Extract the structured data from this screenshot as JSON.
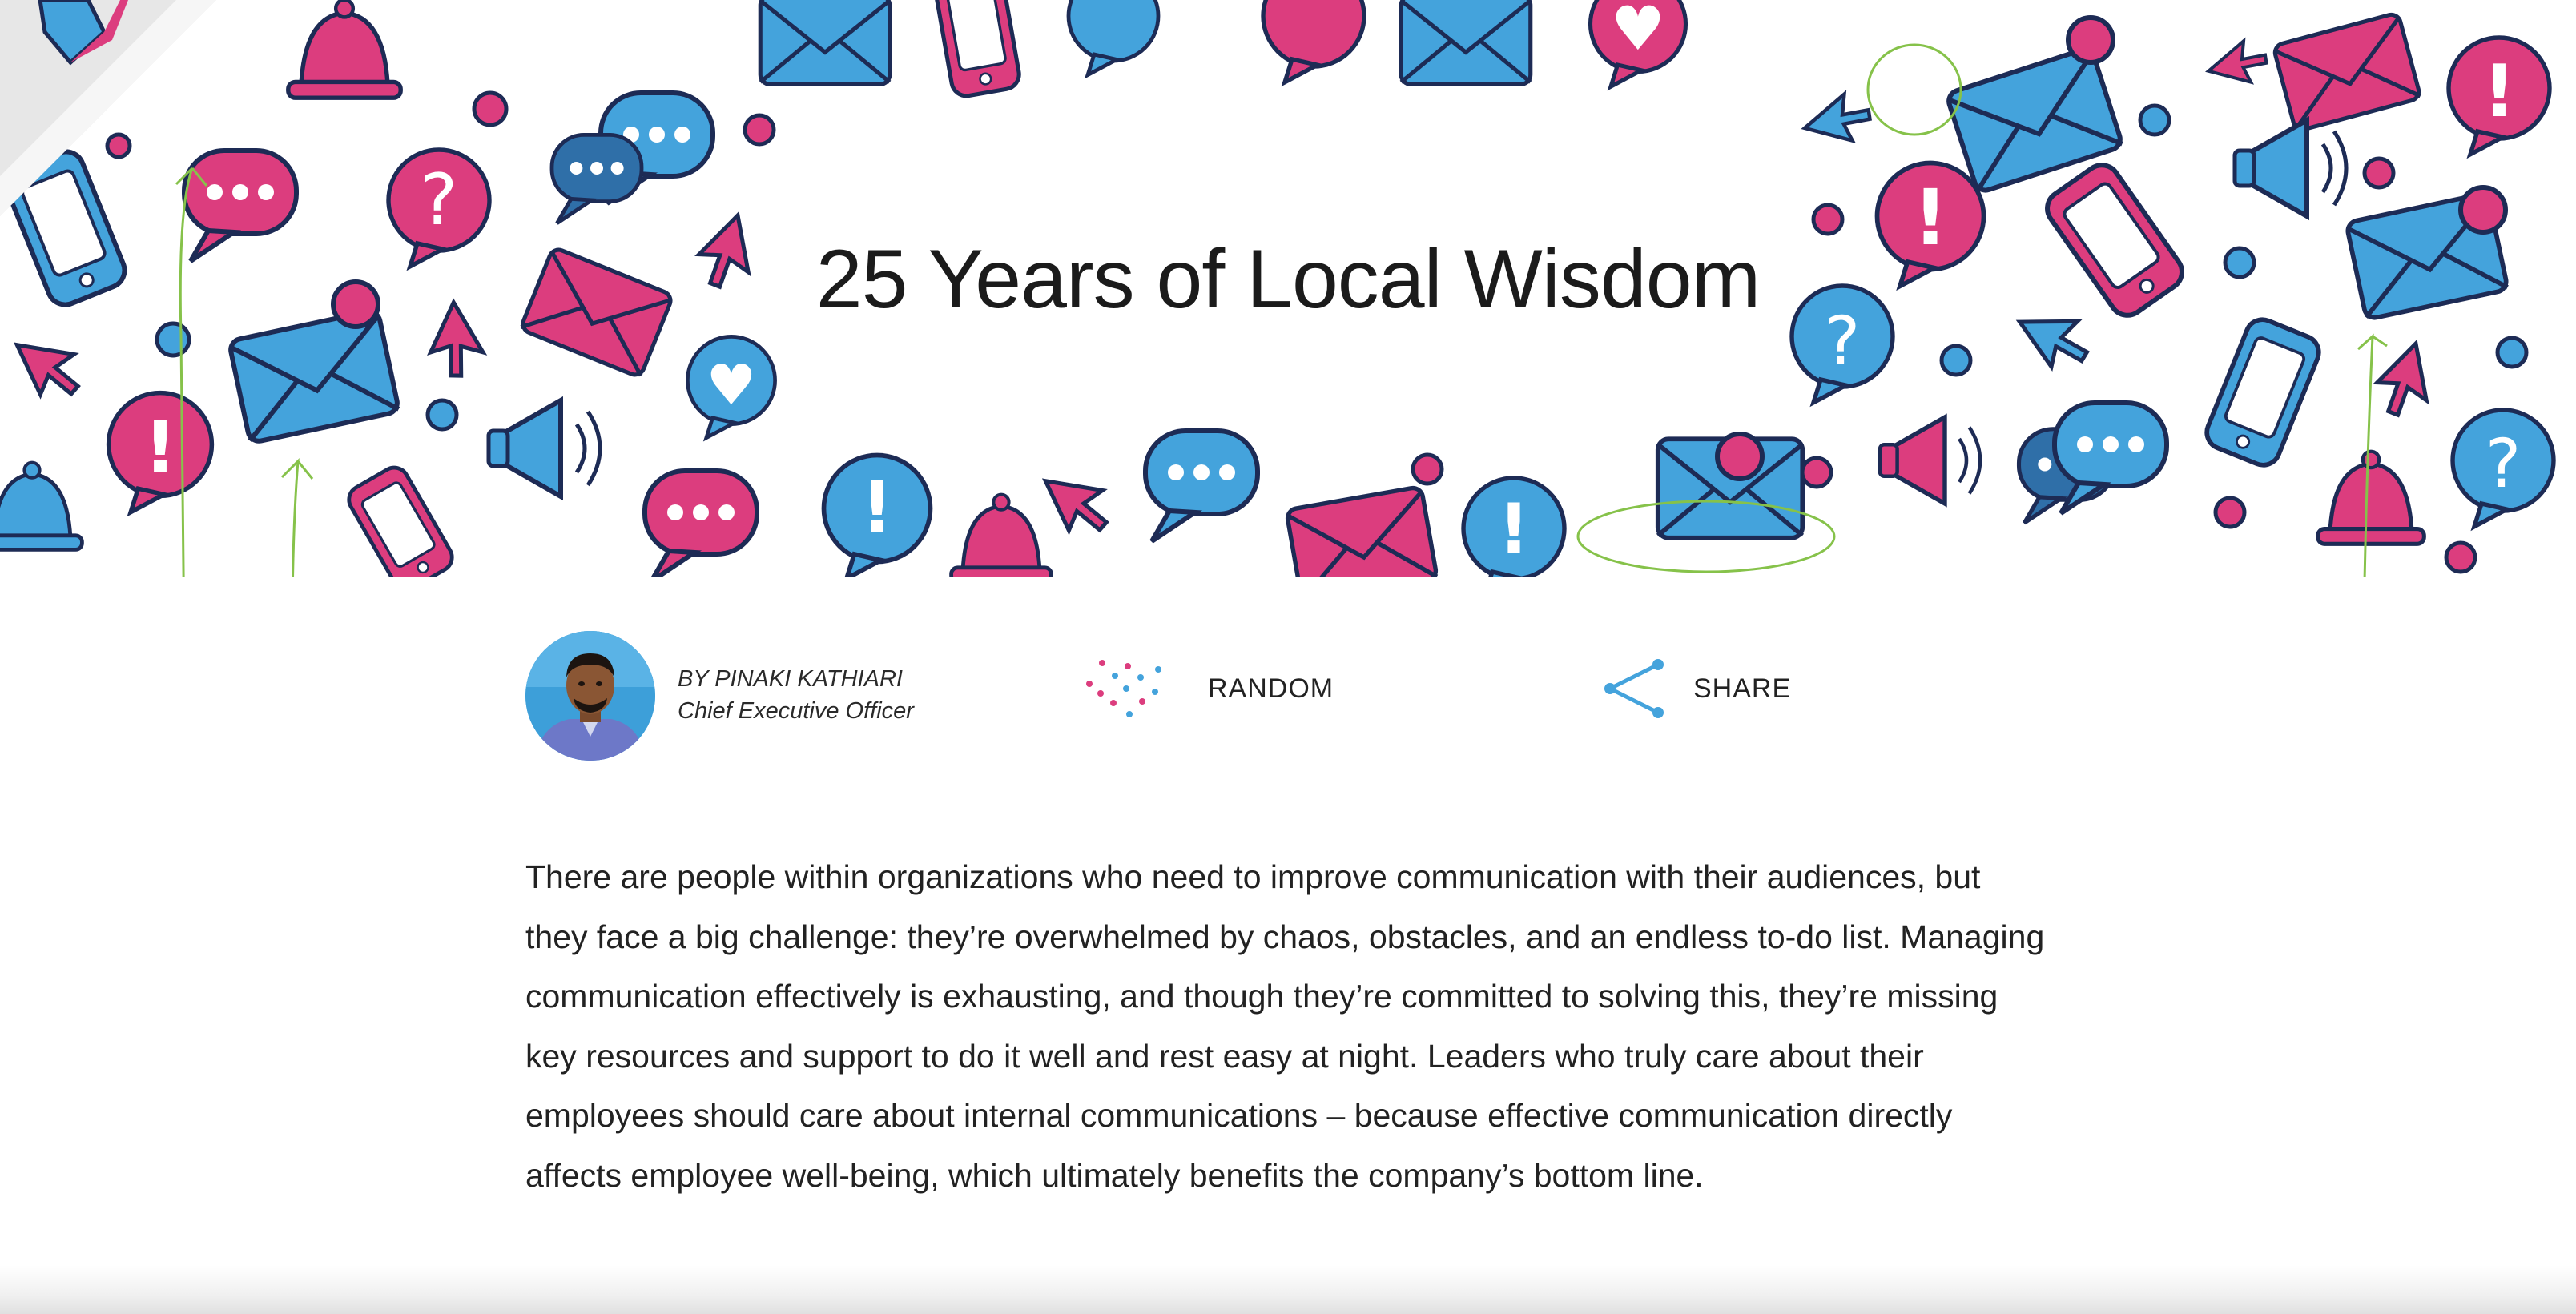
{
  "hero": {
    "title": "25 Years of Local Wisdom",
    "icon_palette": {
      "blue": "#44a3dc",
      "pink": "#dc3d7e",
      "outline": "#1d2b55",
      "sketch": "#86c24a"
    }
  },
  "author": {
    "byline": "BY PINAKI KATHIARI",
    "role": "Chief Executive Officer"
  },
  "actions": {
    "random_label": "RANDOM",
    "share_label": "SHARE"
  },
  "article": {
    "body": "There are people within organizations who need to improve communication with their audiences, but they face a big challenge: they’re overwhelmed by chaos, obstacles, and an endless to-do list. Managing communication effectively is exhausting, and though they’re committed to solving this, they’re missing key resources and support to do it well and rest easy at night. Leaders who truly care about their employees should care about internal communications – because effective communication directly affects employee well-being, which ultimately benefits the company’s bottom line."
  }
}
